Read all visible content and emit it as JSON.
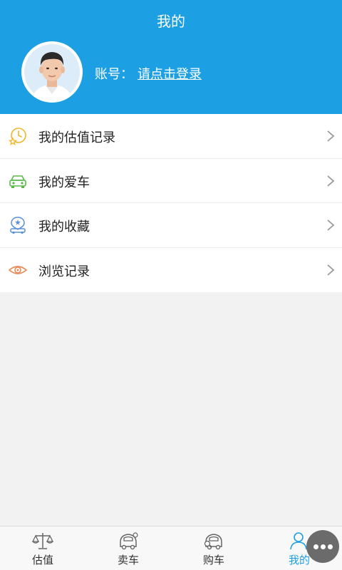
{
  "header": {
    "title": "我的",
    "account_label": "账号：",
    "login_link": "请点击登录",
    "background_color": "#1d9fe3"
  },
  "menu": {
    "items": [
      {
        "label": "我的估值记录",
        "icon": "clock-star-icon"
      },
      {
        "label": "我的爱车",
        "icon": "car-icon"
      },
      {
        "label": "我的收藏",
        "icon": "favorite-car-icon"
      },
      {
        "label": "浏览记录",
        "icon": "eye-icon"
      }
    ]
  },
  "tabbar": {
    "tabs": [
      {
        "label": "估值",
        "icon": "scale-icon",
        "active": false
      },
      {
        "label": "卖车",
        "icon": "car-sell-icon",
        "active": false
      },
      {
        "label": "购车",
        "icon": "car-buy-icon",
        "active": false
      },
      {
        "label": "我的",
        "icon": "person-icon",
        "active": true
      }
    ],
    "active_color": "#1d9fe3"
  },
  "floating": {
    "icon": "more-dots-icon"
  }
}
